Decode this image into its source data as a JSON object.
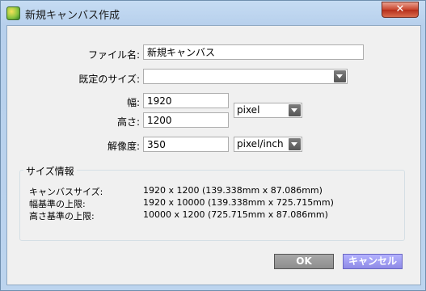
{
  "window": {
    "title": "新規キャンバス作成",
    "close_glyph": "✕"
  },
  "form": {
    "filename_label": "ファイル名:",
    "filename_value": "新規キャンバス",
    "preset_label": "既定のサイズ:",
    "preset_value": "",
    "width_label": "幅:",
    "width_value": "1920",
    "height_label": "高さ:",
    "height_value": "1200",
    "size_unit": "pixel",
    "resolution_label": "解像度:",
    "resolution_value": "350",
    "resolution_unit": "pixel/inch"
  },
  "size_info": {
    "title": "サイズ情報",
    "rows": [
      {
        "label": "キャンバスサイズ:",
        "value": "1920 x 1200 (139.338mm x 87.086mm)"
      },
      {
        "label": "幅基準の上限:",
        "value": "1920 x 10000 (139.338mm x 725.715mm)"
      },
      {
        "label": "高さ基準の上限:",
        "value": "10000 x 1200 (725.715mm x 87.086mm)"
      }
    ]
  },
  "buttons": {
    "ok": "OK",
    "cancel": "キャンセル"
  },
  "icons": {
    "app": "app-icon",
    "dropdown": "dropdown-arrow-icon",
    "close": "close-icon"
  }
}
